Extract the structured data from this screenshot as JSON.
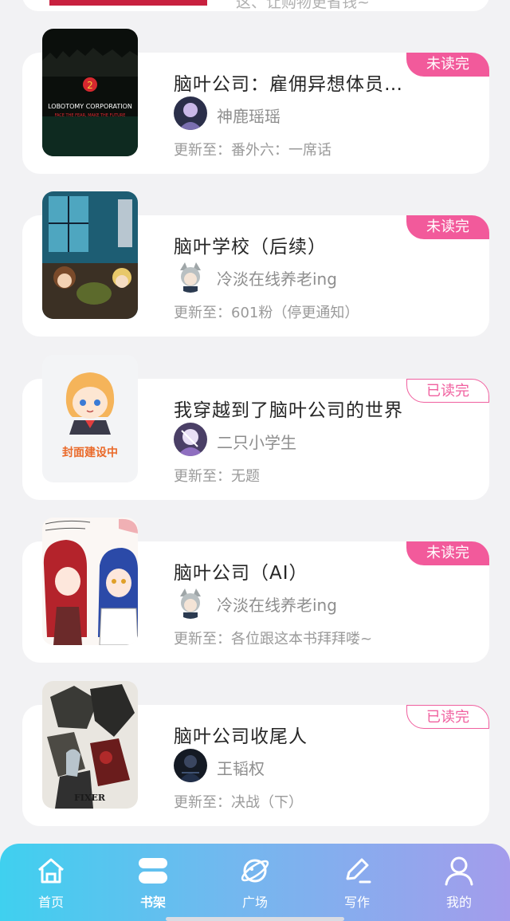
{
  "top_partial": {
    "text": "这、让购物更省钱~"
  },
  "books": [
    {
      "title": "脑叶公司：雇佣异想体员…",
      "author": "神鹿瑶瑶",
      "update": "更新至：番外六：一席话",
      "status": "未读完",
      "status_type": "unread",
      "cover_text": "LOBOTOMY CORPORATION",
      "cover_subtext": "FACE THE FEAR, MAKE THE FUTURE",
      "cover_icon": "lobotomy-corp-cover"
    },
    {
      "title": "脑叶学校（后续）",
      "author": "冷淡在线养老ing",
      "update": "更新至：601粉（停更通知）",
      "status": "未读完",
      "status_type": "unread",
      "cover_icon": "anime-classroom-cover"
    },
    {
      "title": "我穿越到了脑叶公司的世界",
      "author": "二只小学生",
      "update": "更新至：无题",
      "status": "已读完",
      "status_type": "read",
      "cover_text": "封面建设中",
      "cover_icon": "placeholder-girl-cover"
    },
    {
      "title": "脑叶公司（AI）",
      "author": "冷淡在线养老ing",
      "update": "更新至：各位跟这本书拜拜喽~",
      "status": "未读完",
      "status_type": "unread",
      "cover_icon": "anime-sketch-cover"
    },
    {
      "title": "脑叶公司收尾人",
      "author": "王韬权",
      "update": "更新至：决战（下）",
      "status": "已读完",
      "status_type": "read",
      "cover_text": "FIXER",
      "cover_icon": "fixer-cover"
    }
  ],
  "tabs": [
    {
      "label": "首页",
      "icon": "home-icon"
    },
    {
      "label": "书架",
      "icon": "bookshelf-icon",
      "active": true
    },
    {
      "label": "广场",
      "icon": "planet-icon"
    },
    {
      "label": "写作",
      "icon": "pen-icon"
    },
    {
      "label": "我的",
      "icon": "user-icon"
    }
  ],
  "colors": {
    "badge": "#f25a9b",
    "tab_gradient_start": "#3fd0ef",
    "tab_gradient_end": "#a49cec"
  }
}
